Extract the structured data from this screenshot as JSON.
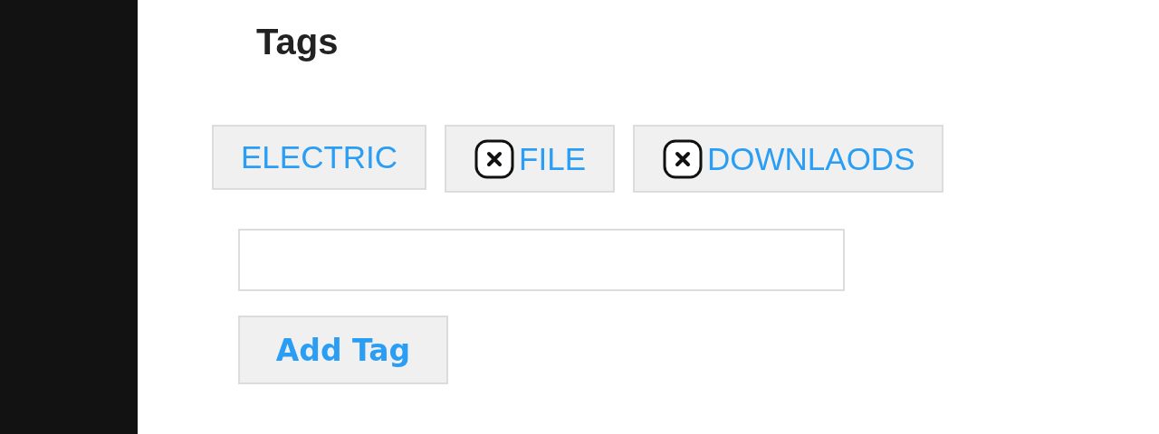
{
  "title": "Tags",
  "tags": [
    {
      "label": "ELECTRIC",
      "removable": false
    },
    {
      "label": "FILE",
      "removable": true
    },
    {
      "label": "DOWNLAODS",
      "removable": true
    }
  ],
  "button": "Add Tag"
}
